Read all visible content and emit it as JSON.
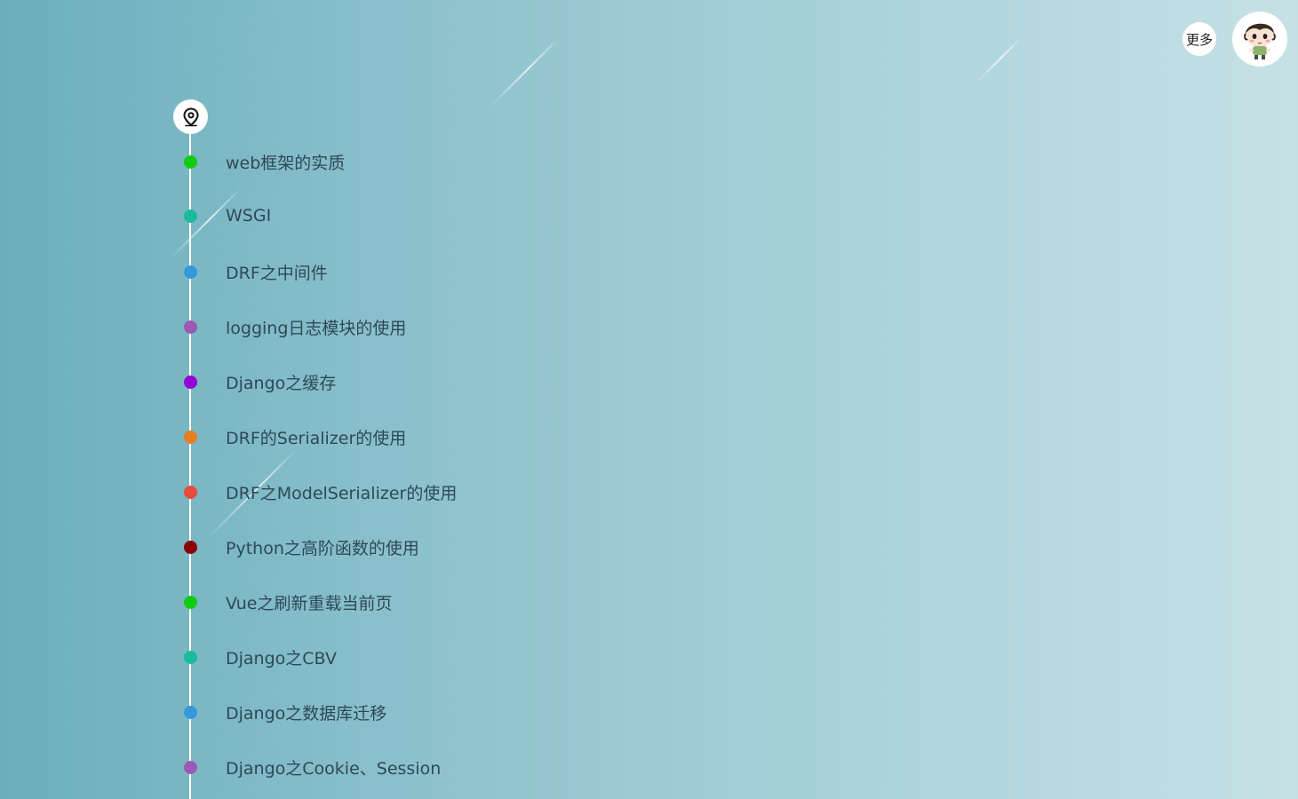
{
  "header": {
    "more_label": "更多",
    "avatar_icon": "cartoon-avatar-icon"
  },
  "timeline": {
    "pin_icon": "location-pin-icon",
    "items": [
      {
        "title": "web框架的实质",
        "color": "#12cc12"
      },
      {
        "title": "WSGI",
        "color": "#1abc9c"
      },
      {
        "title": "DRF之中间件",
        "color": "#3498db"
      },
      {
        "title": "logging日志模块的使用",
        "color": "#9b59b6"
      },
      {
        "title": "Django之缓存",
        "color": "#9400d3"
      },
      {
        "title": "DRF的Serializer的使用",
        "color": "#e67e22"
      },
      {
        "title": "DRF之ModelSerializer的使用",
        "color": "#e74c3c"
      },
      {
        "title": "Python之高阶函数的使用",
        "color": "#8b0000"
      },
      {
        "title": "Vue之刷新重载当前页",
        "color": "#12cc12"
      },
      {
        "title": "Django之CBV",
        "color": "#1abc9c"
      },
      {
        "title": "Django之数据库迁移",
        "color": "#3498db"
      },
      {
        "title": "Django之Cookie、Session",
        "color": "#9b59b6"
      }
    ]
  }
}
